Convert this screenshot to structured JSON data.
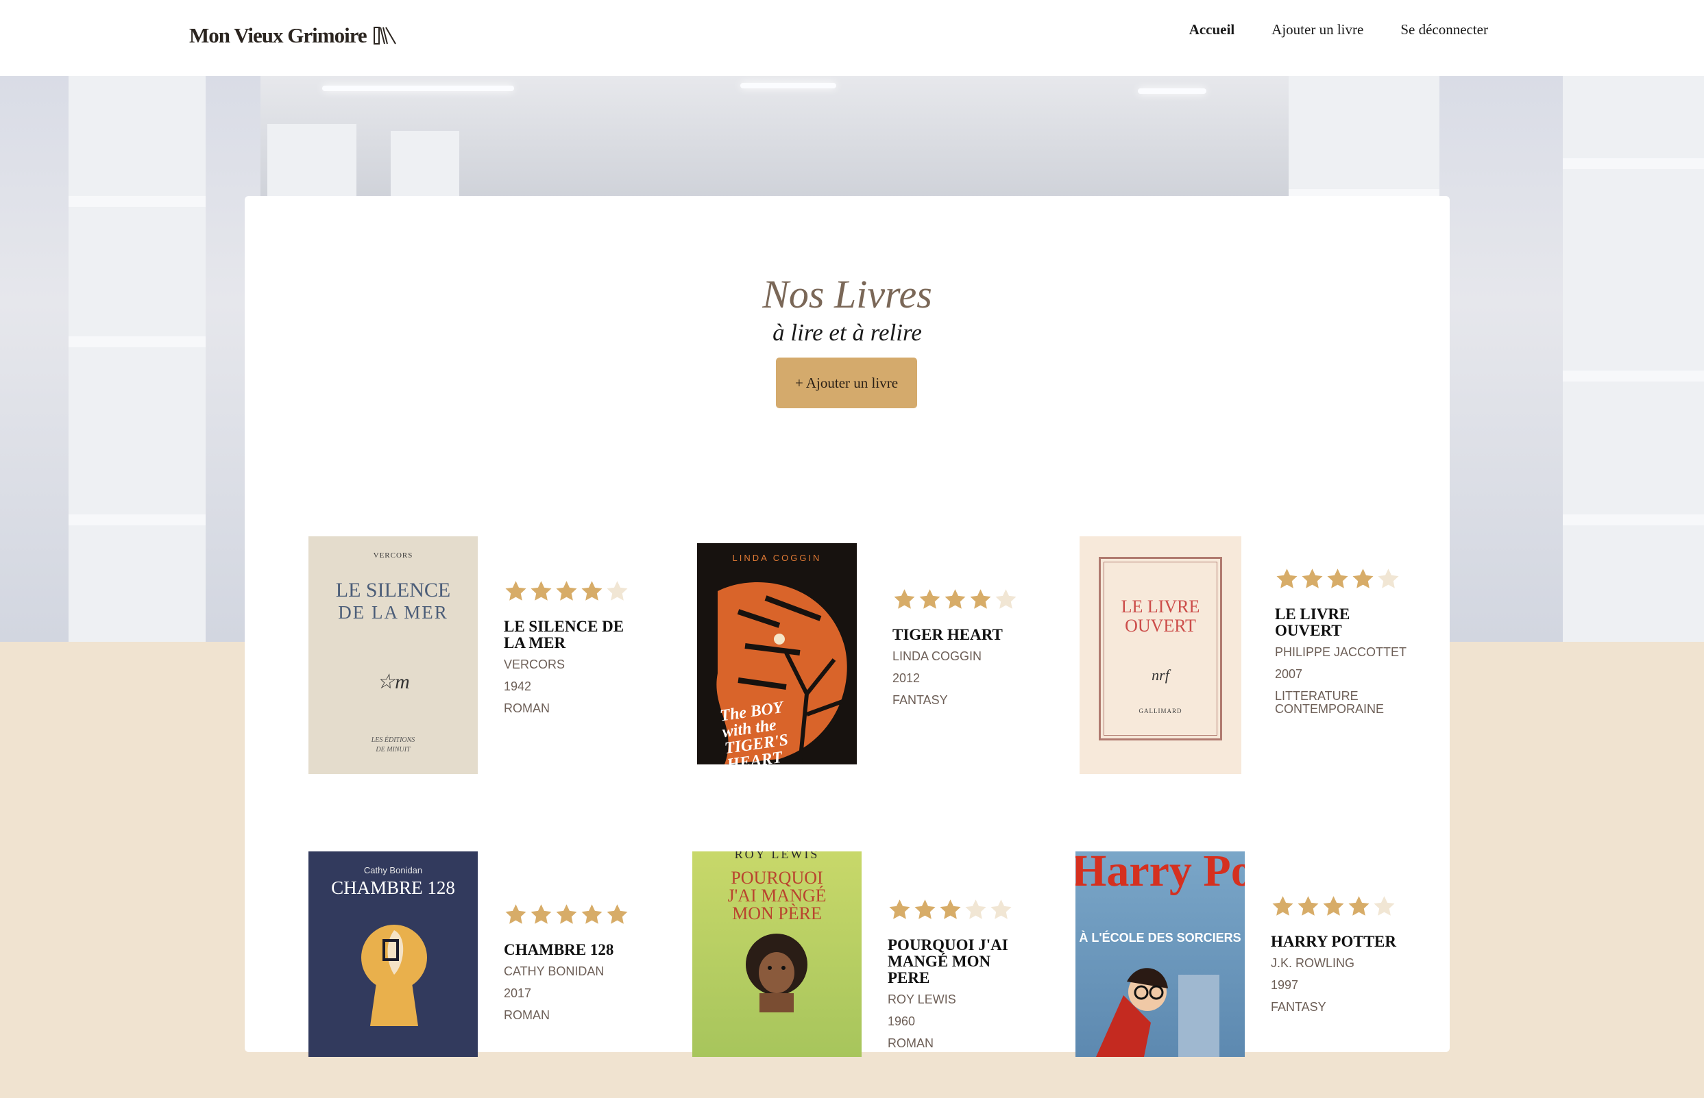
{
  "header": {
    "logo_text": "Mon Vieux Grimoire",
    "nav": [
      {
        "label": "Accueil",
        "active": true
      },
      {
        "label": "Ajouter un livre",
        "active": false
      },
      {
        "label": "Se déconnecter",
        "active": false
      }
    ]
  },
  "hero": {
    "title": "Nos Livres",
    "subtitle": "à lire et à relire",
    "add_button": "+ Ajouter un livre"
  },
  "books": [
    {
      "title": "LE SILENCE DE LA MER",
      "author": "VERCORS",
      "year": "1942",
      "genre": "ROMAN",
      "rating": 4,
      "cover": {
        "top_text": "VERCORS",
        "main_text": "LE SILENCE",
        "main_text_2": "DE LA MER",
        "mark": "m",
        "bottom_text": "LES ÉDITIONS",
        "bottom_text_2": "DE MINUIT"
      }
    },
    {
      "title": "TIGER HEART",
      "author": "LINDA COGGIN",
      "year": "2012",
      "genre": "FANTASY",
      "rating": 4,
      "cover": {
        "top_text": "LINDA COGGIN",
        "main_text": "The BOY with the TIGER'S HEART"
      }
    },
    {
      "title": "LE LIVRE OUVERT",
      "author": "PHILIPPE JACCOTTET",
      "year": "2007",
      "genre": "LITTERATURE CONTEMPORAINE",
      "rating": 4,
      "cover": {
        "main_text": "LE LIVRE",
        "main_text_2": "OUVERT",
        "mark": "nrf",
        "bottom_text": "GALLIMARD"
      }
    },
    {
      "title": "CHAMBRE 128",
      "author": "CATHY BONIDAN",
      "year": "2017",
      "genre": "ROMAN",
      "rating": 5,
      "cover": {
        "top_text": "Cathy Bonidan",
        "main_text": "CHAMBRE 128"
      }
    },
    {
      "title": "POURQUOI J'AI MANGÉ MON PERE",
      "author": "ROY LEWIS",
      "year": "1960",
      "genre": "ROMAN",
      "rating": 3,
      "cover": {
        "top_text": "ROY LEWIS",
        "main_text": "POURQUOI",
        "main_text_2": "J'AI MANGÉ",
        "main_text_3": "MON PÈRE"
      }
    },
    {
      "title": "HARRY POTTER",
      "author": "J.K. ROWLING",
      "year": "1997",
      "genre": "FANTASY",
      "rating": 4,
      "cover": {
        "main_text": "Harry Potter",
        "main_text_2": "À L'ÉCOLE DES SORCIERS"
      }
    }
  ],
  "colors": {
    "accent": "#d4aa6c",
    "star_filled": "#d7ac68",
    "star_empty": "#f1e6d4",
    "title_brown": "#7a6757",
    "page_bg": "#f0e3d0"
  }
}
